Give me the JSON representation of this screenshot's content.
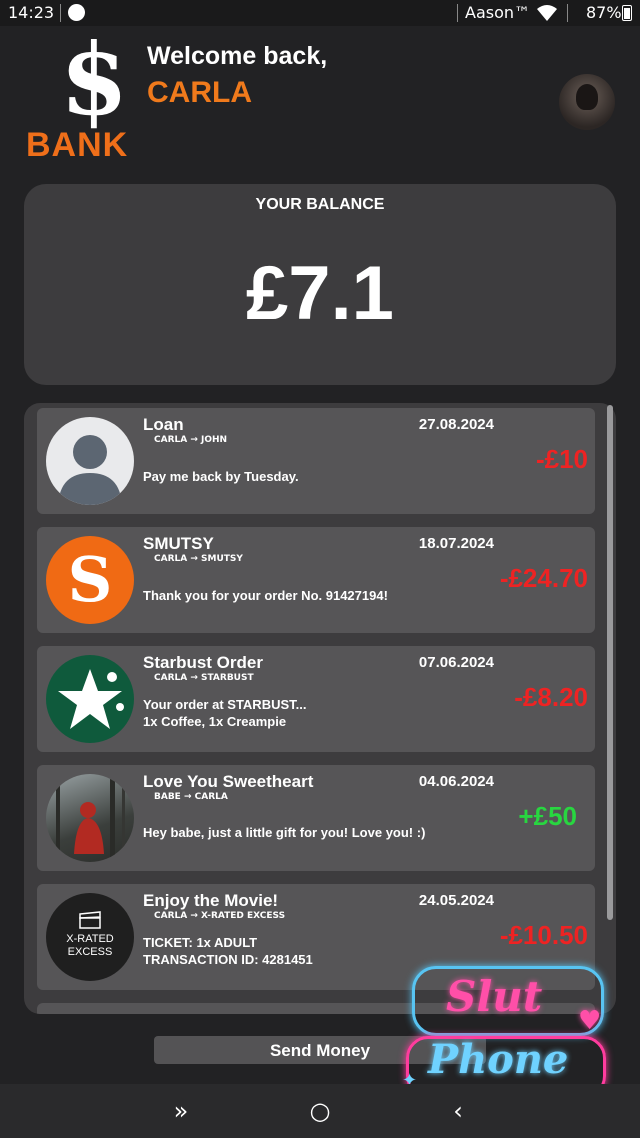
{
  "status_bar": {
    "time": "14:23",
    "carrier": "Aason™",
    "battery": "87%"
  },
  "header": {
    "logo_symbol": "$",
    "logo_text": "BANK",
    "welcome": "Welcome back,",
    "name": "CARLA"
  },
  "balance": {
    "label": "YOUR BALANCE",
    "value": "£7.1"
  },
  "transactions": [
    {
      "title": "Loan",
      "date": "27.08.2024",
      "route": "CARLA → JOHN",
      "message": "Pay me back by Tuesday.",
      "message2": "",
      "amount": "-£10",
      "sign": "neg",
      "avatar": "person-placeholder-icon"
    },
    {
      "title": "SMUTSY",
      "date": "18.07.2024",
      "route": "CARLA → SMUTSY",
      "message": "Thank you for your order No. 91427194!",
      "message2": "",
      "amount": "-£24.70",
      "sign": "neg",
      "avatar": "smutsy-logo",
      "logo_letter": "S"
    },
    {
      "title": "Starbust Order",
      "date": "07.06.2024",
      "route": "CARLA → STARBUST",
      "message": "Your order at STARBUST...",
      "message2": "1x Coffee, 1x Creampie",
      "amount": "-£8.20",
      "sign": "neg",
      "avatar": "starbust-logo"
    },
    {
      "title": "Love You Sweetheart",
      "date": "04.06.2024",
      "route": "BABE → CARLA",
      "message": "Hey babe, just a little gift for you! Love you! :)",
      "message2": "",
      "amount": "+£50",
      "sign": "pos",
      "avatar": "photo-avatar"
    },
    {
      "title": "Enjoy the Movie!",
      "date": "24.05.2024",
      "route": "CARLA → X-RATED EXCESS",
      "message": "TICKET: 1x ADULT",
      "message2": "TRANSACTION ID: 4281451",
      "amount": "-£10.50",
      "sign": "neg",
      "avatar": "xrated-logo",
      "logo_line1": "X-RATED",
      "logo_line2": "EXCESS"
    }
  ],
  "send_button": {
    "label": "Send Money"
  },
  "watermark": {
    "line1": "Slut",
    "line2": "Phone"
  },
  "nav": {
    "recent": "»",
    "home": "○",
    "back": "‹"
  }
}
